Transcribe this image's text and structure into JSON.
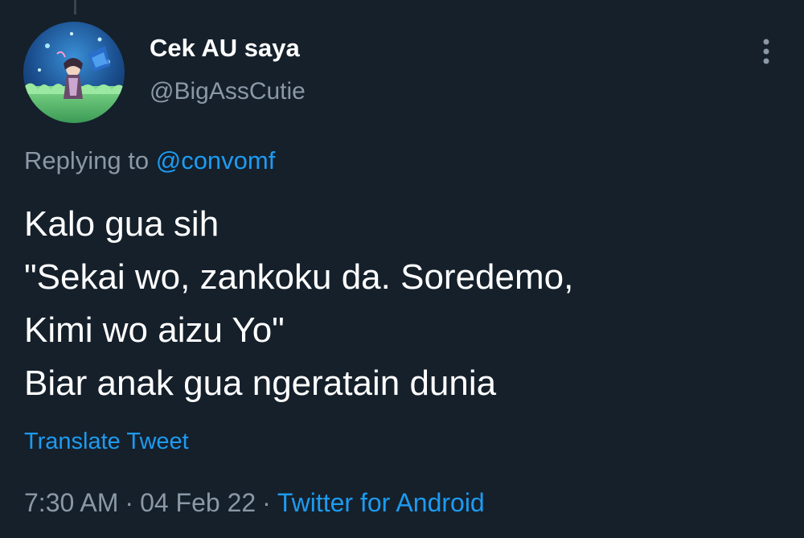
{
  "tweet": {
    "author": {
      "display_name": "Cek AU saya",
      "handle": "@BigAssCutie",
      "avatar": "anime-character-avatar"
    },
    "replying_prefix": "Replying to",
    "replying_to": "@convomf",
    "text_lines": [
      "Kalo gua sih",
      "\"Sekai wo, zankoku da. Soredemo,",
      "Kimi wo aizu Yo\"",
      "Biar anak gua ngeratain dunia"
    ],
    "translate_label": "Translate Tweet",
    "time": "7:30 AM",
    "date": "04 Feb 22",
    "separator": "·",
    "source": "Twitter for Android"
  },
  "icons": {
    "more": "more-vertical-icon"
  },
  "colors": {
    "background": "#15202b",
    "text_primary": "#ffffff",
    "text_secondary": "#8b98a5",
    "link": "#1d9bf0"
  }
}
